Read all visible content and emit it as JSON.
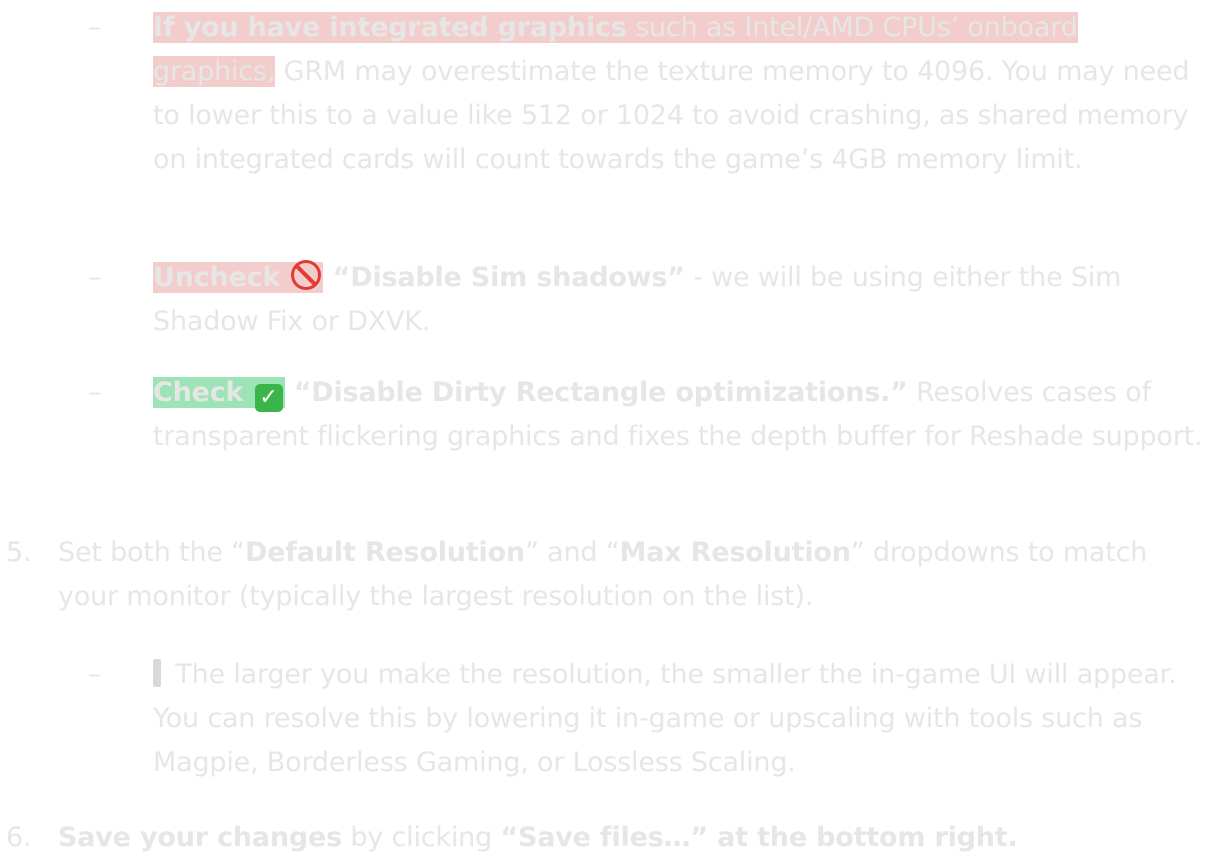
{
  "dash": "–",
  "item1": {
    "hl": "If you have integrated graphics",
    "hl_rest": " such as Intel/AMD CPUs’ onboard",
    "line2_hl": "graphics,",
    "rest": " GRM may overestimate the texture memory to 4096. You may need to lower this to a value like 512 or 1024 to avoid crashing, as shared memory on integrated cards will count towards the game’s 4GB memory limit."
  },
  "item2": {
    "hl": "Uncheck ",
    "bold": " “Disable Sim shadows”",
    "rest": " - we will be using either the Sim Shadow Fix or DXVK.",
    "icon": "prohibited-icon"
  },
  "item3": {
    "hl": "Check ",
    "bold": " “Disable Dirty Rectangle optimizations.”",
    "rest": " Resolves cases of transparent flickering graphics and fixes the depth buffer for Reshade support.",
    "icon": "check-mark-icon"
  },
  "step5": {
    "num": "5.",
    "t1": "Set both the “",
    "b1": "Default Resolution",
    "t2": "” and “",
    "b2": "Max Resolution",
    "t3": "” dropdowns to match your monitor (typically the largest resolution on the list)."
  },
  "item4": {
    "icon": "warning-icon",
    "rest": " The larger you make the resolution, the smaller the in-game UI will appear. You can resolve this by lowering it in-game or upscaling with tools such as Magpie, Borderless Gaming, or Lossless Scaling."
  },
  "step6": {
    "num": "6.",
    "b1": "Save your changes",
    "t1": " by clicking ",
    "b2": "“Save files…” at the bottom right."
  }
}
